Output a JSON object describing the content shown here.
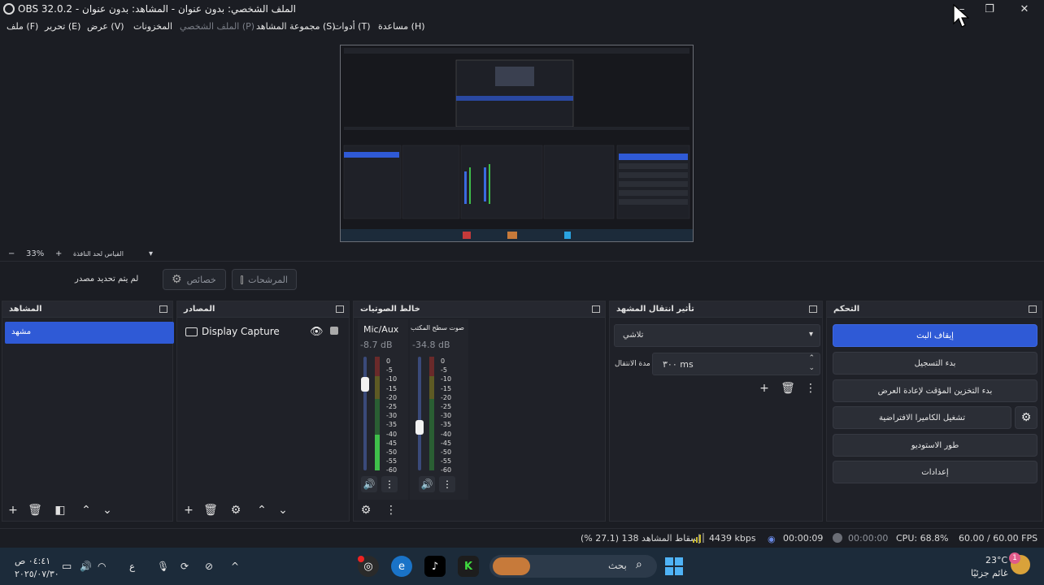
{
  "window": {
    "title": "OBS 32.0.2 - الملف الشخصي: بدون عنوان - المشاهد: بدون عنوان"
  },
  "menu": {
    "items": [
      {
        "label": "ملف (F)",
        "disabled": false
      },
      {
        "label": "تحرير (E)",
        "disabled": false
      },
      {
        "label": "عرض (V)",
        "disabled": false
      },
      {
        "label": "المخزونات",
        "disabled": false
      },
      {
        "label": "الملف الشخصي (P)",
        "disabled": true
      },
      {
        "label": "مجموعة المشاهد (S)",
        "disabled": false
      },
      {
        "label": "أدوات (T)",
        "disabled": false
      },
      {
        "label": "مساعدة (H)",
        "disabled": false
      }
    ]
  },
  "zoom": {
    "minus": "−",
    "value": "33%",
    "plus": "+",
    "fit_label": "القياس لحد النافذة"
  },
  "source_toolbar": {
    "no_source": "لم يتم تحديد مصدر",
    "properties": "خصائص",
    "filters": "المرشحات"
  },
  "docks": {
    "scenes": {
      "title": "المشاهد",
      "items": [
        "مشهد"
      ]
    },
    "sources": {
      "title": "المصادر",
      "items": [
        "Display Capture"
      ]
    },
    "mixer": {
      "title": "خالط الصوتيات",
      "channels": [
        {
          "name": "Mic/Aux",
          "db": "-8.7 dB",
          "level": 0.24
        },
        {
          "name": "صوت سطح المكتب",
          "db": "-34.8 dB",
          "level": 0.62
        }
      ],
      "scale": [
        "0",
        "-5",
        "-10",
        "-15",
        "-20",
        "-25",
        "-30",
        "-35",
        "-40",
        "-45",
        "-50",
        "-55",
        "-60"
      ]
    },
    "transitions": {
      "title": "تأثير انتقال المشهد",
      "type": "تلاشي",
      "duration_label": "مدة الانتقال",
      "duration_value": "٣٠٠ ms"
    },
    "controls": {
      "title": "التحكم",
      "buttons": [
        "إيقاف البث",
        "بدء التسجيل",
        "بدء التخزين المؤقت لإعادة العرض",
        "تشغيل الكاميرا الافتراضية",
        "طور الاستوديو",
        "إعدادات"
      ]
    }
  },
  "status": {
    "dropped": "إسقاط المشاهد 138 (27.1 %)",
    "bitrate": "4439 kbps",
    "stream_time": "00:00:09",
    "rec_time": "00:00:00",
    "cpu": "CPU: 68.8%",
    "fps": "60.00 / 60.00 FPS"
  },
  "taskbar": {
    "search_placeholder": "بحث",
    "weather_temp": "23°C",
    "weather_desc": "غائم جزئيًا",
    "weather_badge": "1",
    "time": "٠٤:٤١ ص",
    "date": "٢٠٢٥/٠٧/٣٠",
    "lang": "ع"
  },
  "colors": {
    "accent": "#2f5ad6",
    "meter_green": "#3fbf4a",
    "meter_yellow": "#c9b92e",
    "meter_red": "#c43a3a"
  }
}
